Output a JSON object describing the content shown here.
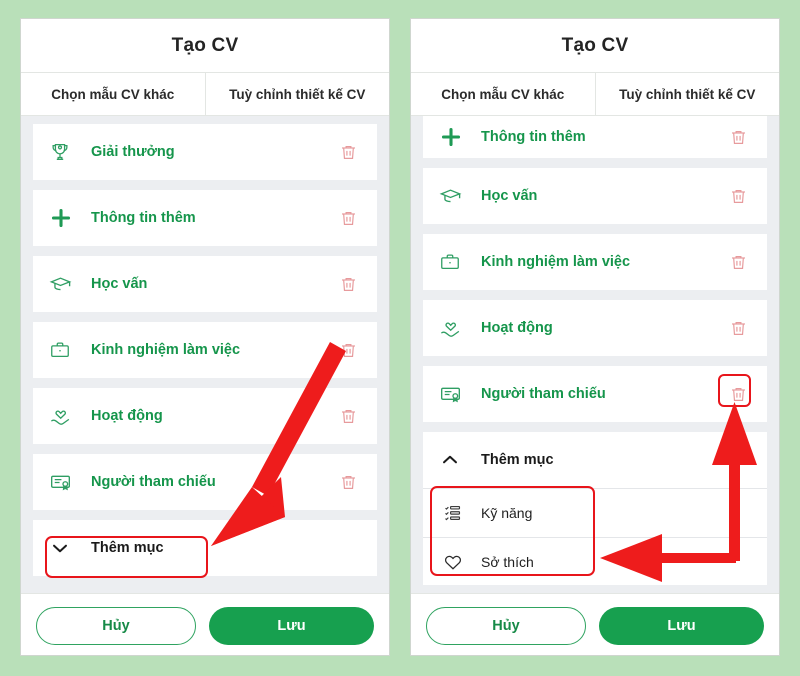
{
  "theme": {
    "background": "#b9e0b9",
    "panel_bg": "#ffffff",
    "list_bg": "#eceef1",
    "brand_green": "#17a04f",
    "label_green": "#15954b",
    "trash_red": "#e79a9c",
    "annotation_red": "#e8151b",
    "title_dark": "#242424"
  },
  "panels": [
    {
      "id": "left",
      "title": "Tạo CV",
      "tabs": [
        {
          "label": "Chọn mẫu CV khác"
        },
        {
          "label": "Tuỳ chỉnh thiết kế CV"
        }
      ],
      "scrolled": false,
      "rows": [
        {
          "label": "Giải thưởng",
          "icon": "trophy-icon",
          "trash": "trash-icon"
        },
        {
          "label": "Thông tin thêm",
          "icon": "plus-icon",
          "trash": "trash-icon"
        },
        {
          "label": "Học vấn",
          "icon": "graduation-icon",
          "trash": "trash-icon"
        },
        {
          "label": "Kinh nghiệm làm việc",
          "icon": "briefcase-icon",
          "trash": "trash-icon"
        },
        {
          "label": "Hoạt động",
          "icon": "hand-heart-icon",
          "trash": "trash-icon"
        },
        {
          "label": "Người tham chiếu",
          "icon": "certificate-icon",
          "trash": "trash-icon"
        }
      ],
      "add_more": {
        "label": "Thêm mục",
        "chevron": "chevron-down-icon",
        "expanded": false,
        "items": []
      },
      "footer": {
        "cancel_label": "Hủy",
        "save_label": "Lưu"
      }
    },
    {
      "id": "right",
      "title": "Tạo CV",
      "tabs": [
        {
          "label": "Chọn mẫu CV khác"
        },
        {
          "label": "Tuỳ chỉnh thiết kế CV"
        }
      ],
      "scrolled": true,
      "rows": [
        {
          "label": "Thông tin thêm",
          "icon": "plus-icon",
          "trash": "trash-icon"
        },
        {
          "label": "Học vấn",
          "icon": "graduation-icon",
          "trash": "trash-icon"
        },
        {
          "label": "Kinh nghiệm làm việc",
          "icon": "briefcase-icon",
          "trash": "trash-icon"
        },
        {
          "label": "Hoạt động",
          "icon": "hand-heart-icon",
          "trash": "trash-icon"
        },
        {
          "label": "Người tham chiếu",
          "icon": "certificate-icon",
          "trash": "trash-icon"
        }
      ],
      "add_more": {
        "label": "Thêm mục",
        "chevron": "chevron-up-icon",
        "expanded": true,
        "items": [
          {
            "label": "Kỹ năng",
            "icon": "skills-list-icon"
          },
          {
            "label": "Sở thích",
            "icon": "heart-icon"
          }
        ]
      },
      "footer": {
        "cancel_label": "Hủy",
        "save_label": "Lưu"
      }
    }
  ],
  "annotations": {
    "left_arrow": {
      "name": "pointer-arrow-to-them-muc",
      "color": "#e8151b"
    },
    "left_highlight": {
      "name": "highlight-them-muc",
      "color": "#e8151b"
    },
    "right_highlight_trash": {
      "name": "highlight-delete-nguoi-tham-chieu",
      "color": "#e8151b"
    },
    "right_highlight_items": {
      "name": "highlight-added-items",
      "color": "#e8151b"
    },
    "right_arrow_up": {
      "name": "pointer-arrow-to-delete",
      "color": "#e8151b"
    },
    "right_arrow_left": {
      "name": "pointer-arrow-to-so-thich",
      "color": "#e8151b"
    }
  }
}
